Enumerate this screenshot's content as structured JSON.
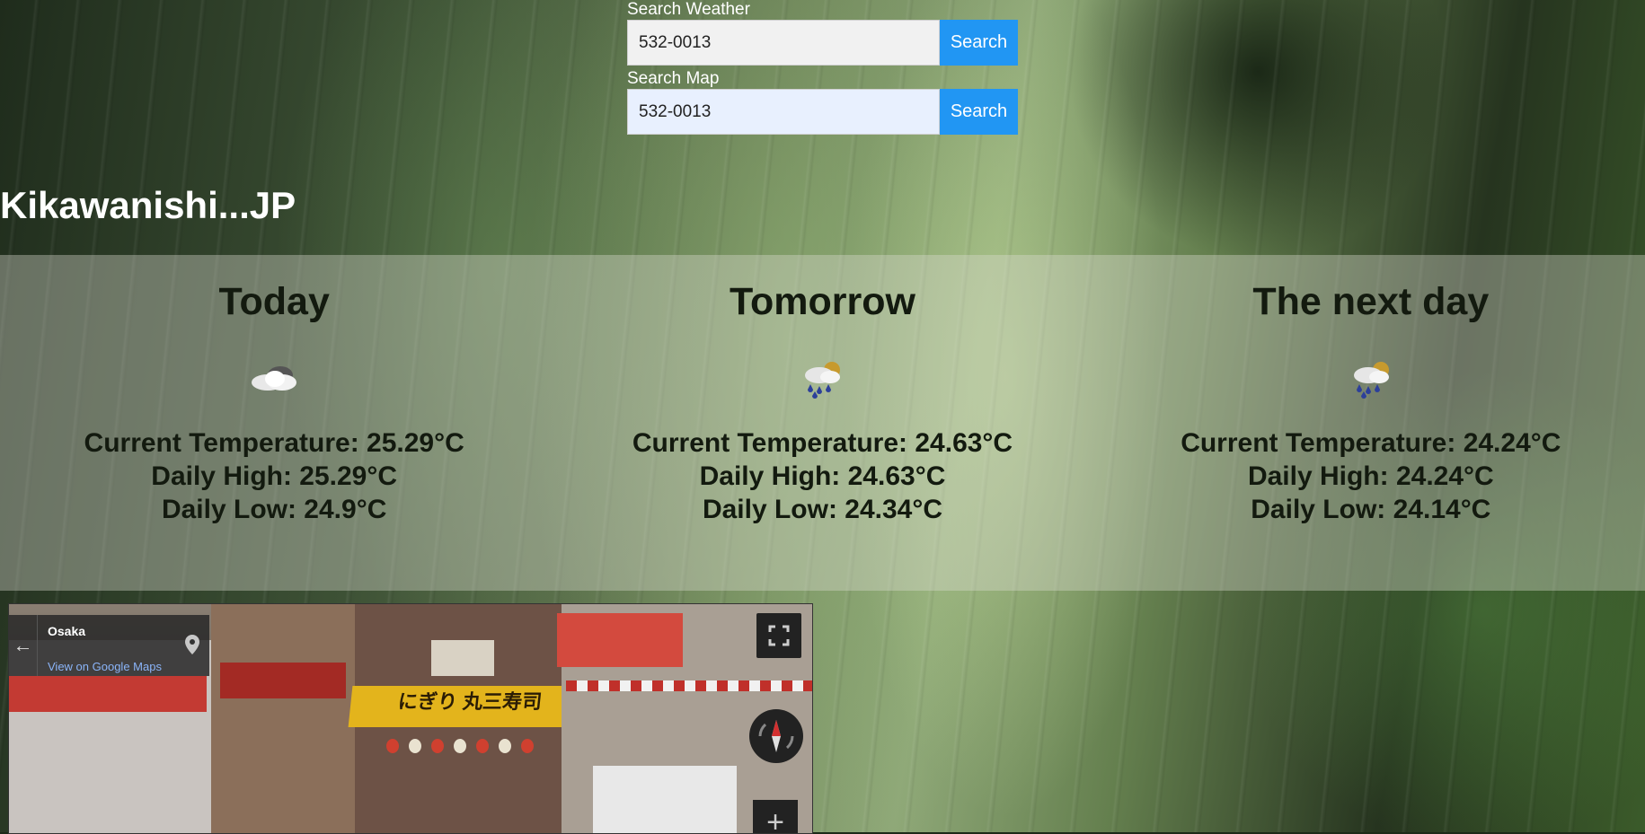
{
  "search_weather": {
    "label": "Search Weather",
    "value": "532-0013",
    "button": "Search"
  },
  "search_map": {
    "label": "Search Map",
    "value": "532-0013",
    "button": "Search"
  },
  "location": {
    "title": "Kikawanishi...JP"
  },
  "forecast": {
    "days": [
      {
        "title": "Today",
        "icon": "cloudy-icon",
        "current": "Current Temperature: 25.29°C",
        "high": "Daily High: 25.29°C",
        "low": "Daily Low: 24.9°C"
      },
      {
        "title": "Tomorrow",
        "icon": "rain-sun-icon",
        "current": "Current Temperature: 24.63°C",
        "high": "Daily High: 24.63°C",
        "low": "Daily Low: 24.34°C"
      },
      {
        "title": "The next day",
        "icon": "rain-sun-icon",
        "current": "Current Temperature: 24.24°C",
        "high": "Daily High: 24.24°C",
        "low": "Daily Low: 24.14°C"
      }
    ]
  },
  "streetview": {
    "place": "Osaka",
    "link": "View on Google Maps",
    "awning_text": "にぎり 丸三寿司"
  }
}
